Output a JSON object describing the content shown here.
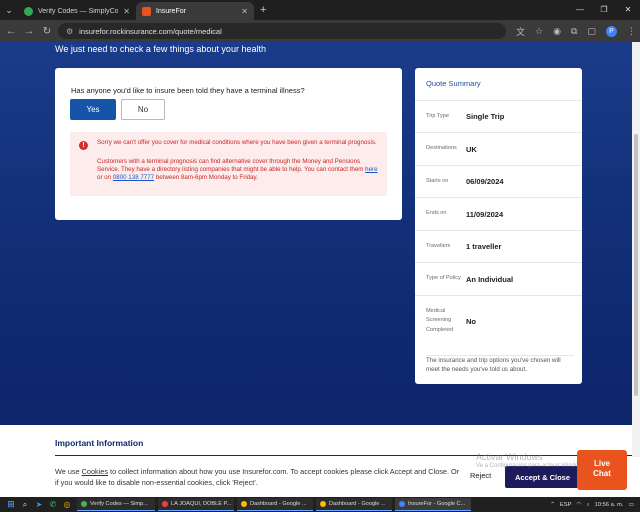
{
  "browser": {
    "tabs": [
      {
        "title": "Verify Codes — SimplyCodes",
        "favicon_color": "#34a853"
      },
      {
        "title": "InsureFor",
        "favicon_color": "#e8531e"
      }
    ],
    "url": "insurefor.rockinsurance.com/quote/medical",
    "new_tab_symbol": "+",
    "profile_initial": "P"
  },
  "page": {
    "heading": "We just need to check a few things about your health",
    "question": "Has anyone you'd like to insure been told they have a terminal illness?",
    "yes_label": "Yes",
    "no_label": "No",
    "alert": {
      "title": "Sorry we can't offer you cover for medical conditions where you have been given a terminal prognosis.",
      "body_prefix": "Customers with a terminal prognosis can find alternative cover through the Money and Pensions Service. They have a directory listing companies that might be able to help. You can contact them ",
      "link_here": "here",
      "body_mid": " or on ",
      "phone": "0800 138 7777",
      "body_suffix": " between 8am-6pm Monday to Friday."
    }
  },
  "summary": {
    "title": "Quote Summary",
    "rows": [
      {
        "key": "Trip Type",
        "value": "Single Trip"
      },
      {
        "key": "Destinations",
        "value": "UK"
      },
      {
        "key": "Starts on",
        "value": "06/09/2024"
      },
      {
        "key": "Ends on",
        "value": "11/09/2024"
      },
      {
        "key": "Travellers",
        "value": "1 traveller"
      },
      {
        "key": "Type of Policy",
        "value": "An Individual"
      },
      {
        "key": "Medical Screening Completed",
        "value": "No"
      }
    ],
    "footer": "The insurance and trip options you've chosen will meet the needs you've told us about."
  },
  "info": {
    "title": "Important Information"
  },
  "cookie": {
    "prefix": "We use ",
    "link": "Cookies",
    "suffix": " to collect information about how you use Insurefor.com. To accept cookies please click Accept and Close. Or if you would like to disable non-essential cookies, click 'Reject'.",
    "reject_label": "Reject",
    "accept_label": "Accept & Close"
  },
  "watermark": {
    "line1": "Activar Windows",
    "line2": "Ve a Configuración para activar Windows."
  },
  "livechat": {
    "line1": "Live",
    "line2": "Chat"
  },
  "taskbar": {
    "apps": [
      {
        "label": "Verify Codes — Simp..."
      },
      {
        "label": "LA JOAQUI, DOBLE P..."
      },
      {
        "label": "Dashboard - Google ..."
      },
      {
        "label": "Dashboard - Google ..."
      },
      {
        "label": "InsureFor - Google C..."
      }
    ],
    "language": "ESP",
    "time": "10:56 a. m."
  }
}
